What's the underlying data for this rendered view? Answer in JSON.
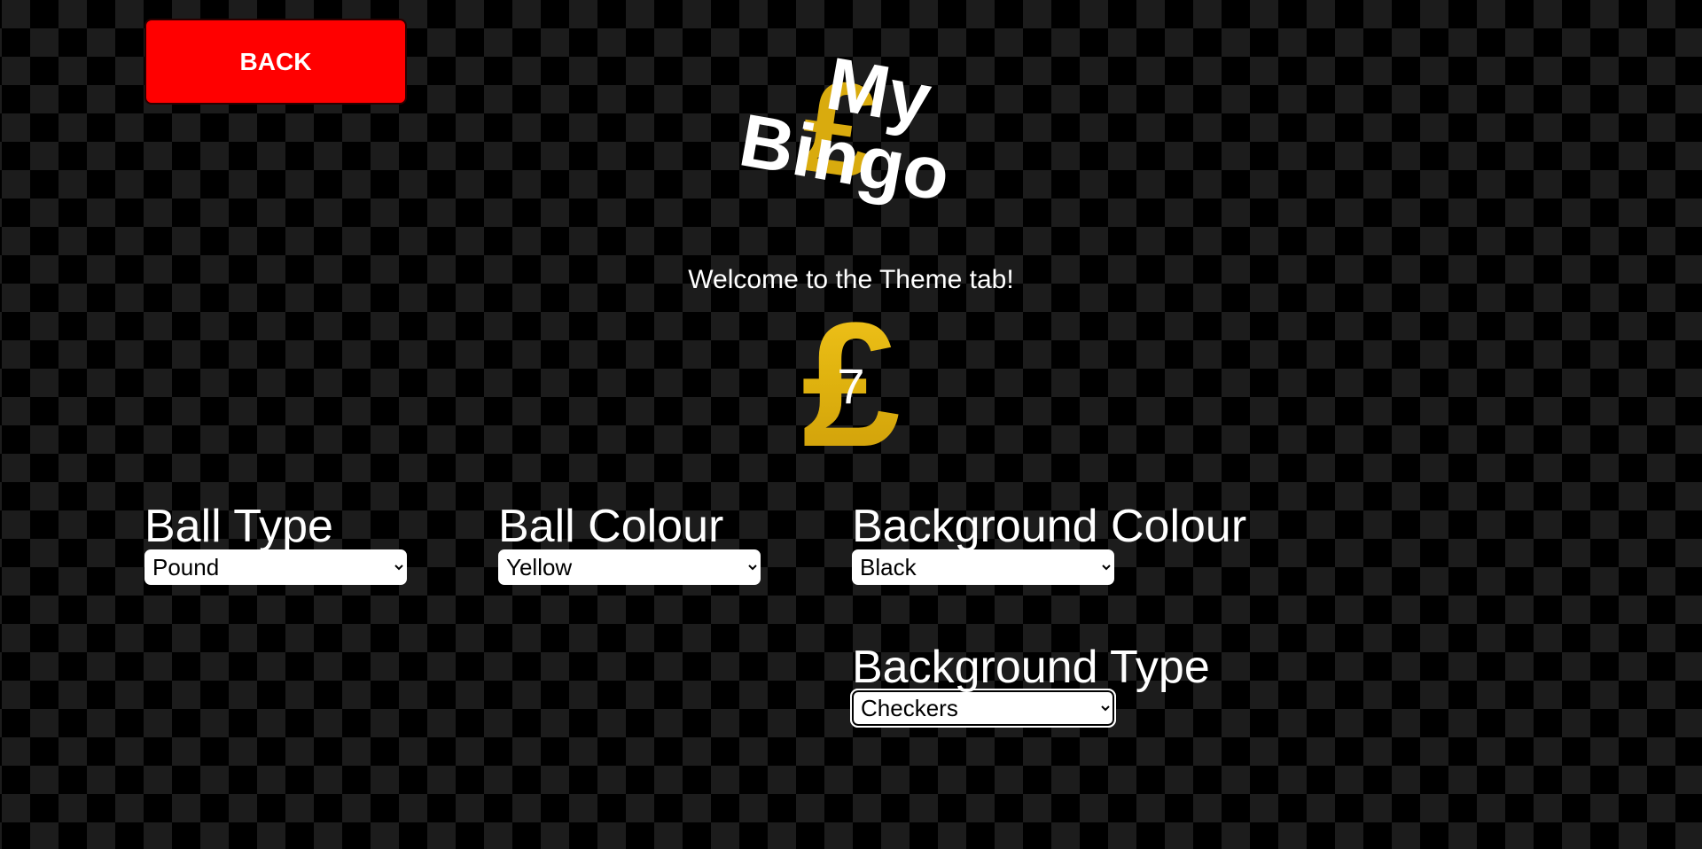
{
  "header": {
    "back_label": "BACK"
  },
  "logo": {
    "symbol": "£",
    "line1": "My",
    "line2": "Bingo"
  },
  "welcome": "Welcome to the Theme tab!",
  "preview_ball": {
    "symbol": "£",
    "number": "7",
    "color": "#e0b30f"
  },
  "settings": {
    "ball_type": {
      "label": "Ball Type",
      "selected": "Pound"
    },
    "ball_colour": {
      "label": "Ball Colour",
      "selected": "Yellow"
    },
    "background_colour": {
      "label": "Background Colour",
      "selected": "Black"
    },
    "background_type": {
      "label": "Background Type",
      "selected": "Checkers"
    }
  },
  "colors": {
    "back_button": "#ff0000",
    "background_dark": "#000000",
    "background_checker": "#1c1c1c",
    "text": "#ffffff"
  }
}
